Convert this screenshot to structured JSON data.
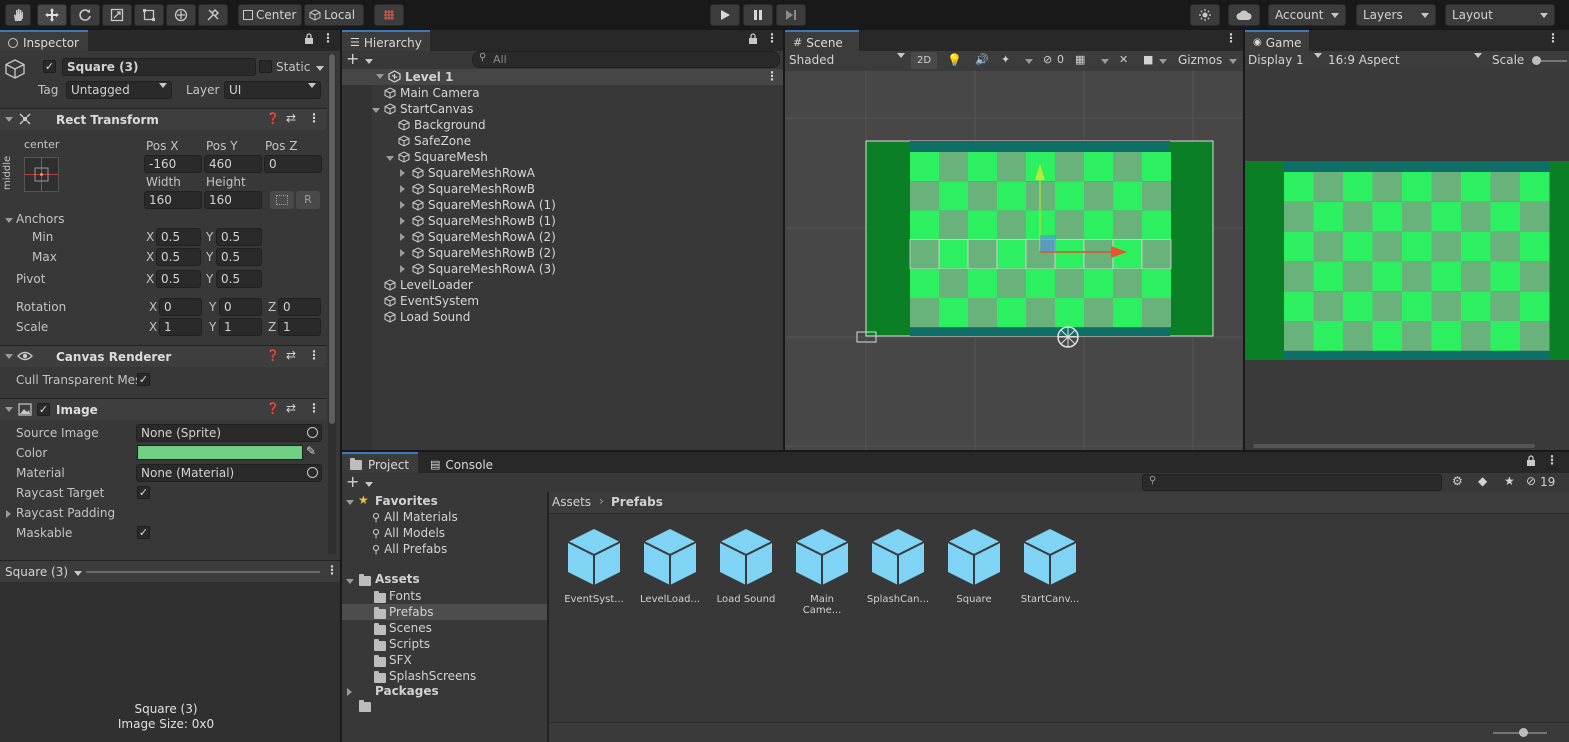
{
  "toolbar": {
    "pivot_mode": "Center",
    "pivot_rotation": "Local",
    "account": "Account",
    "layers": "Layers",
    "layout": "Layout",
    "tools": [
      "hand-tool-icon",
      "move-tool-icon",
      "rotate-tool-icon",
      "scale-tool-icon",
      "rect-tool-icon",
      "transform-tool-icon",
      "custom-tool-icon"
    ]
  },
  "inspector": {
    "tab": "Inspector",
    "object_name": "Square (3)",
    "static_label": "Static",
    "tag_label": "Tag",
    "tag_value": "Untagged",
    "layer_label": "Layer",
    "layer_value": "UI",
    "rect_transform": {
      "title": "Rect Transform",
      "anchor_h": "center",
      "anchor_v": "middle",
      "pos_x_label": "Pos X",
      "pos_x": "-160",
      "pos_y_label": "Pos Y",
      "pos_y": "460",
      "pos_z_label": "Pos Z",
      "pos_z": "0",
      "width_label": "Width",
      "width": "160",
      "height_label": "Height",
      "height": "160",
      "r_label": "R",
      "anchors_label": "Anchors",
      "min_label": "Min",
      "min_x": "0.5",
      "min_y": "0.5",
      "max_label": "Max",
      "max_x": "0.5",
      "max_y": "0.5",
      "pivot_label": "Pivot",
      "pivot_x": "0.5",
      "pivot_y": "0.5",
      "rotation_label": "Rotation",
      "rot_x": "0",
      "rot_y": "0",
      "rot_z": "0",
      "scale_label": "Scale",
      "scale_x": "1",
      "scale_y": "1",
      "scale_z": "1",
      "x": "X",
      "y": "Y",
      "z": "Z"
    },
    "canvas_renderer": {
      "title": "Canvas Renderer",
      "cull_label": "Cull Transparent Mes"
    },
    "image": {
      "title": "Image",
      "source_label": "Source Image",
      "source_value": "None (Sprite)",
      "color_label": "Color",
      "color_value": "#6fcf83",
      "material_label": "Material",
      "material_value": "None (Material)",
      "raycast_label": "Raycast Target",
      "padding_label": "Raycast Padding",
      "maskable_label": "Maskable"
    },
    "preview": {
      "title": "Square (3)",
      "caption_name": "Square (3)",
      "caption_size": "Image Size: 0x0"
    }
  },
  "hierarchy": {
    "tab": "Hierarchy",
    "search_placeholder": "All",
    "scene": "Level 1",
    "items": [
      {
        "label": "Main Camera",
        "depth": 1,
        "arrow": "none"
      },
      {
        "label": "StartCanvas",
        "depth": 1,
        "arrow": "down"
      },
      {
        "label": "Background",
        "depth": 2,
        "arrow": "none"
      },
      {
        "label": "SafeZone",
        "depth": 2,
        "arrow": "none"
      },
      {
        "label": "SquareMesh",
        "depth": 2,
        "arrow": "down"
      },
      {
        "label": "SquareMeshRowA",
        "depth": 3,
        "arrow": "right"
      },
      {
        "label": "SquareMeshRowB",
        "depth": 3,
        "arrow": "right"
      },
      {
        "label": "SquareMeshRowA (1)",
        "depth": 3,
        "arrow": "right"
      },
      {
        "label": "SquareMeshRowB (1)",
        "depth": 3,
        "arrow": "right"
      },
      {
        "label": "SquareMeshRowA (2)",
        "depth": 3,
        "arrow": "right"
      },
      {
        "label": "SquareMeshRowB (2)",
        "depth": 3,
        "arrow": "right"
      },
      {
        "label": "SquareMeshRowA (3)",
        "depth": 3,
        "arrow": "right"
      },
      {
        "label": "LevelLoader",
        "depth": 1,
        "arrow": "none"
      },
      {
        "label": "EventSystem",
        "depth": 1,
        "arrow": "none"
      },
      {
        "label": "Load Sound",
        "depth": 1,
        "arrow": "none"
      }
    ]
  },
  "scene": {
    "tab": "Scene",
    "shading": "Shaded",
    "mode_2d": "2D",
    "hidden_count": "0",
    "gizmos": "Gizmos"
  },
  "game": {
    "tab": "Game",
    "display": "Display 1",
    "aspect": "16:9 Aspect",
    "scale_label": "Scale"
  },
  "project": {
    "tab_project": "Project",
    "tab_console": "Console",
    "favorites_label": "Favorites",
    "favorites": [
      "All Materials",
      "All Models",
      "All Prefabs"
    ],
    "assets_label": "Assets",
    "folders": [
      "Fonts",
      "Prefabs",
      "Scenes",
      "Scripts",
      "SFX",
      "SplashScreens"
    ],
    "packages_label": "Packages",
    "breadcrumb_root": "Assets",
    "breadcrumb_current": "Prefabs",
    "hidden_count": "19",
    "prefabs": [
      "EventSyst...",
      "LevelLoad...",
      "Load Sound",
      "Main Came...",
      "SplashCan...",
      "Square",
      "StartCanv..."
    ]
  }
}
